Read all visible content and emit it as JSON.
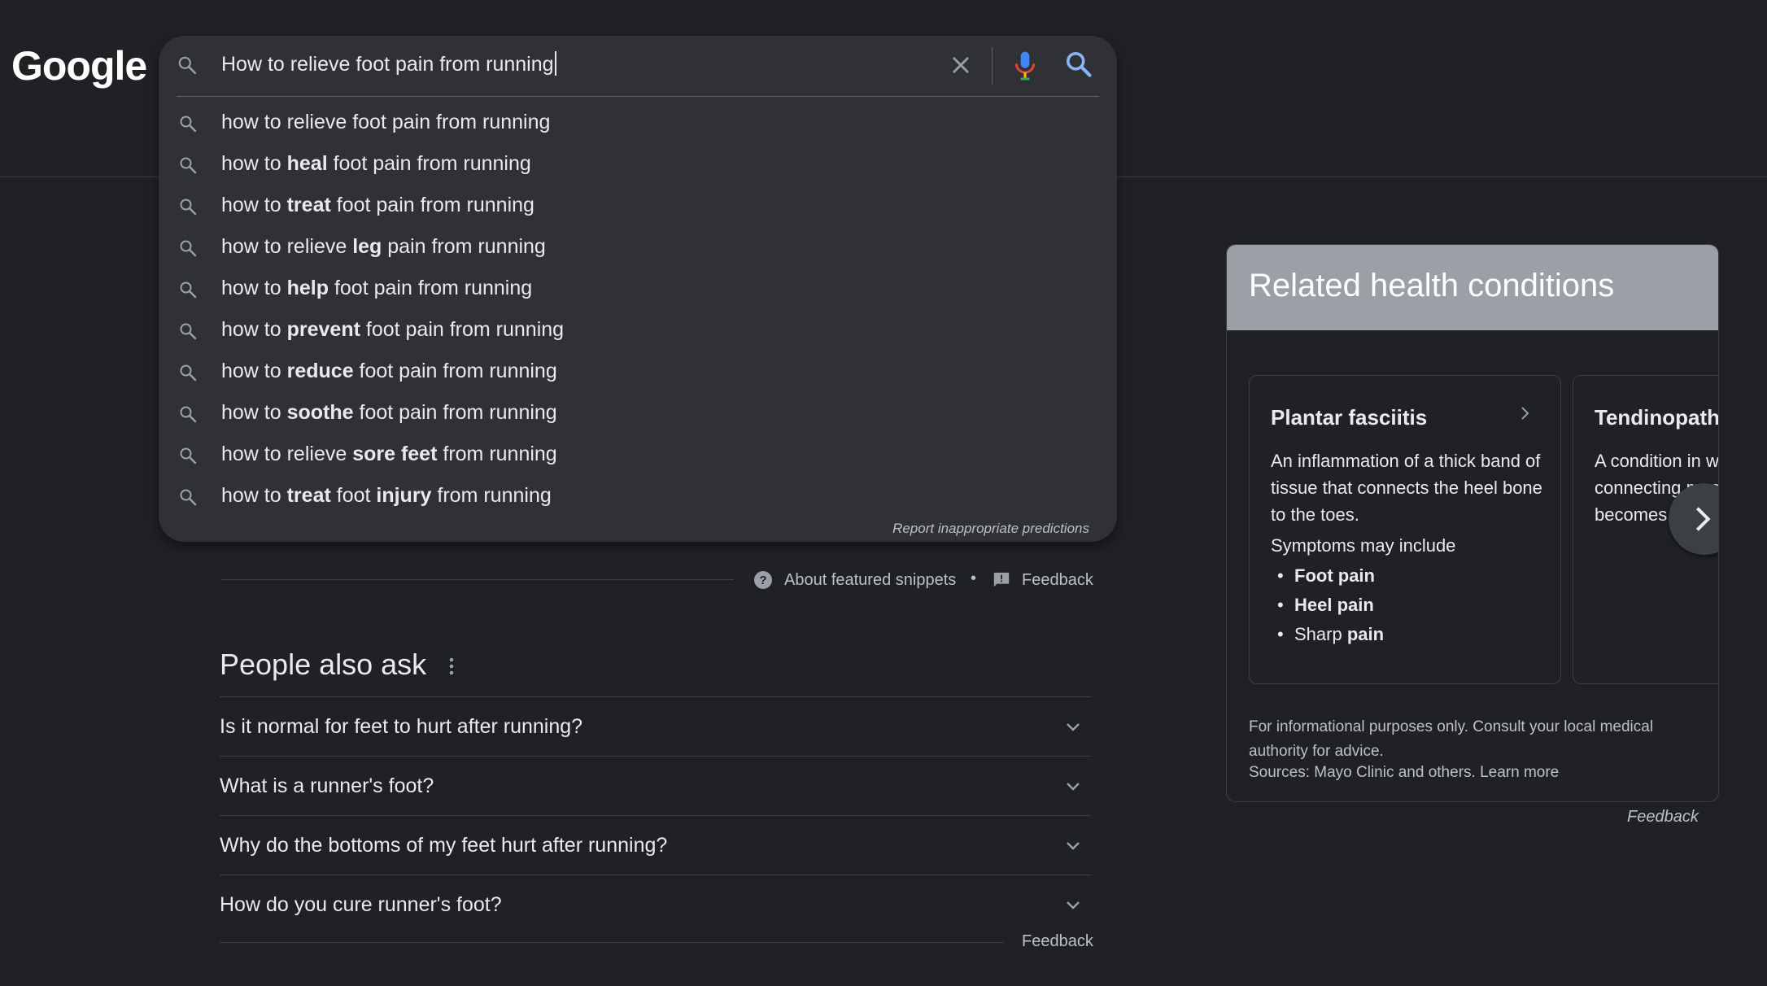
{
  "logo": "Google",
  "search": {
    "query": "How to relieve foot pain from running",
    "suggestions": [
      {
        "pre": "how to relieve foot pain from running",
        "bold": "",
        "post": ""
      },
      {
        "pre": "how to ",
        "bold": "heal",
        "post": " foot pain from running"
      },
      {
        "pre": "how to ",
        "bold": "treat",
        "post": " foot pain from running"
      },
      {
        "pre": "how to relieve ",
        "bold": "leg",
        "post": " pain from running"
      },
      {
        "pre": "how to ",
        "bold": "help",
        "post": " foot pain from running"
      },
      {
        "pre": "how to ",
        "bold": "prevent",
        "post": " foot pain from running"
      },
      {
        "pre": "how to ",
        "bold": "reduce",
        "post": " foot pain from running"
      },
      {
        "pre": "how to ",
        "bold": "soothe",
        "post": " foot pain from running"
      },
      {
        "pre": "how to relieve ",
        "bold": "sore feet",
        "post": " from running"
      },
      {
        "pre": "how to ",
        "bold": "treat",
        "mid": " foot ",
        "bold2": "injury",
        "post": " from running"
      }
    ],
    "report_link": "Report inappropriate predictions"
  },
  "snippet_footer": {
    "about": "About featured snippets",
    "separator": "•",
    "feedback": "Feedback"
  },
  "people_also_ask": {
    "title": "People also ask",
    "questions": [
      "Is it normal for feet to hurt after running?",
      "What is a runner's foot?",
      "Why do the bottoms of my feet hurt after running?",
      "How do you cure runner's foot?"
    ],
    "feedback": "Feedback"
  },
  "health": {
    "title": "Related health conditions",
    "cards": [
      {
        "name": "Plantar fasciitis",
        "description": "An inflammation of a thick band of tissue that connects the heel bone to the toes.",
        "symptoms_label": "Symptoms may include",
        "symptoms": [
          {
            "pre": "",
            "bold": "Foot pain",
            "post": ""
          },
          {
            "pre": "",
            "bold": "Heel pain",
            "post": ""
          },
          {
            "pre": "Sharp ",
            "bold": "pain",
            "post": ""
          }
        ]
      },
      {
        "name": "Tendinopathy",
        "description": "A condition in which connecting muscle becomes inflamed"
      }
    ],
    "disclaimer": "For informational purposes only. Consult your local medical authority for advice.",
    "sources": "Sources: Mayo Clinic and others. Learn more",
    "feedback": "Feedback"
  },
  "colors": {
    "background": "#202124",
    "panel": "#303134",
    "mic_blue": "#4285f4",
    "mic_red": "#ea4335",
    "mic_yellow": "#fbbc04",
    "mic_green": "#34a853",
    "search_icon_blue": "#8ab4f8"
  }
}
